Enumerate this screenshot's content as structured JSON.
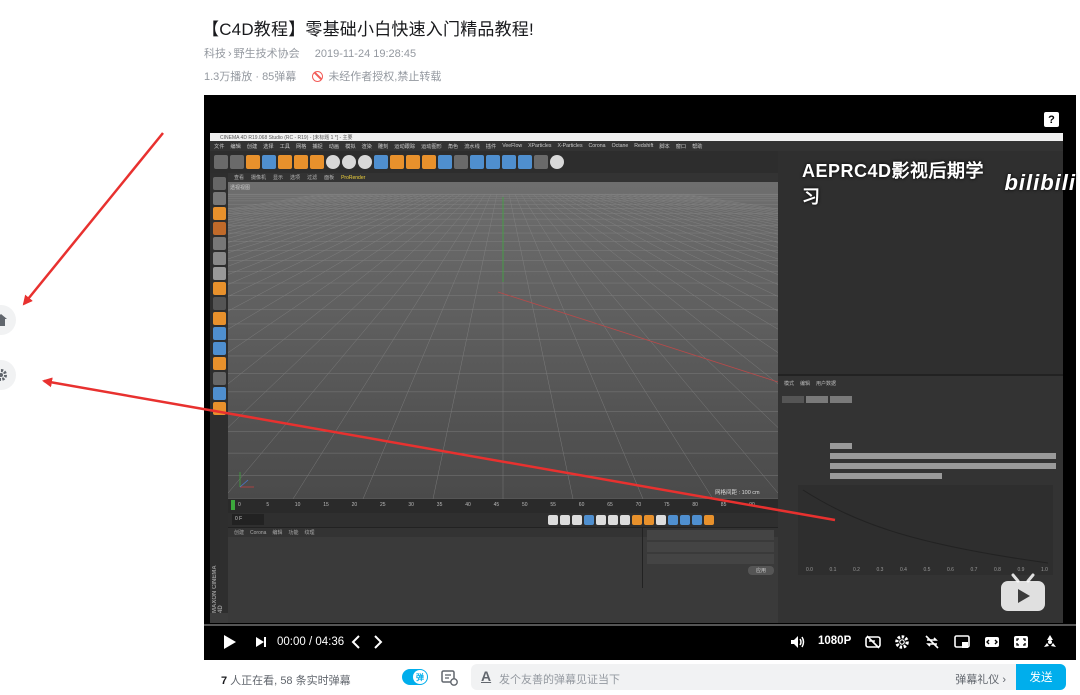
{
  "video": {
    "title": "【C4D教程】零基础小白快速入门精品教程!",
    "category": "科技",
    "subcategory": "野生技术协会",
    "date": "2019-11-24 19:28:45",
    "stats": "1.3万播放 · 85弹幕",
    "copyright_notice": "未经作者授权,禁止转载"
  },
  "player": {
    "help_label": "?",
    "current_time": "00:00",
    "duration": "04:36",
    "time_separator": "/",
    "quality": "1080P",
    "watermark_text": "AEPRC4D影视后期学习",
    "watermark_logo": "bilibili",
    "icons": [
      "play-icon",
      "next-icon",
      "prev-chapter-icon",
      "next-chapter-icon",
      "volume-icon",
      "danmaku-toggle-icon",
      "settings-icon",
      "loop-icon",
      "pip-icon",
      "widescreen-icon",
      "fullscreen-web-icon",
      "fullscreen-icon"
    ]
  },
  "c4d": {
    "window_title": "CINEMA 4D R19.068 Studio (RC - R19) - [未标题 1 *] - 主要",
    "menus": [
      "文件",
      "编辑",
      "创建",
      "选择",
      "工具",
      "网格",
      "捕捉",
      "动画",
      "模拟",
      "渲染",
      "雕刻",
      "运动跟踪",
      "运动图形",
      "角色",
      "流水线",
      "插件",
      "VeeFlow",
      "XParticles",
      "X-Particles",
      "Corona",
      "Octane",
      "Redshift",
      "脚本",
      "窗口",
      "帮助"
    ],
    "viewport_menus": [
      "查看",
      "摄像机",
      "显示",
      "选项",
      "过滤",
      "面板",
      "ProRender"
    ],
    "viewport_label": "透视视图",
    "grid_distance": "网格间距 : 100 cm",
    "timeline_ticks": [
      "0",
      "5",
      "10",
      "15",
      "20",
      "25",
      "30",
      "35",
      "40",
      "45",
      "50",
      "55",
      "60",
      "65",
      "70",
      "75",
      "80",
      "85",
      "90"
    ],
    "frame_value": "0 F",
    "bottom_tabs": [
      "创建",
      "Corona",
      "编辑",
      "功能",
      "纹理"
    ],
    "logo_text": "MAXON CINEMA 4D",
    "attr_tabs": [
      "模式",
      "编辑",
      "用户数据"
    ],
    "curve_x_ticks": [
      "0.0",
      "0.1",
      "0.2",
      "0.3",
      "0.4",
      "0.5",
      "0.6",
      "0.7",
      "0.8",
      "0.9",
      "1.0"
    ],
    "apply_button": "应用"
  },
  "danmaku": {
    "viewer_count": "7",
    "viewer_text": " 人正在看,",
    "live_count_text": "58 条实时弹幕",
    "toggle_label": "弹",
    "input_placeholder": "发个友善的弹幕见证当下",
    "etiquette": "弹幕礼仪",
    "send_label": "发送"
  },
  "colors": {
    "accent": "#00aeec",
    "arrow": "#e8312f",
    "text_secondary": "#9499a0"
  }
}
